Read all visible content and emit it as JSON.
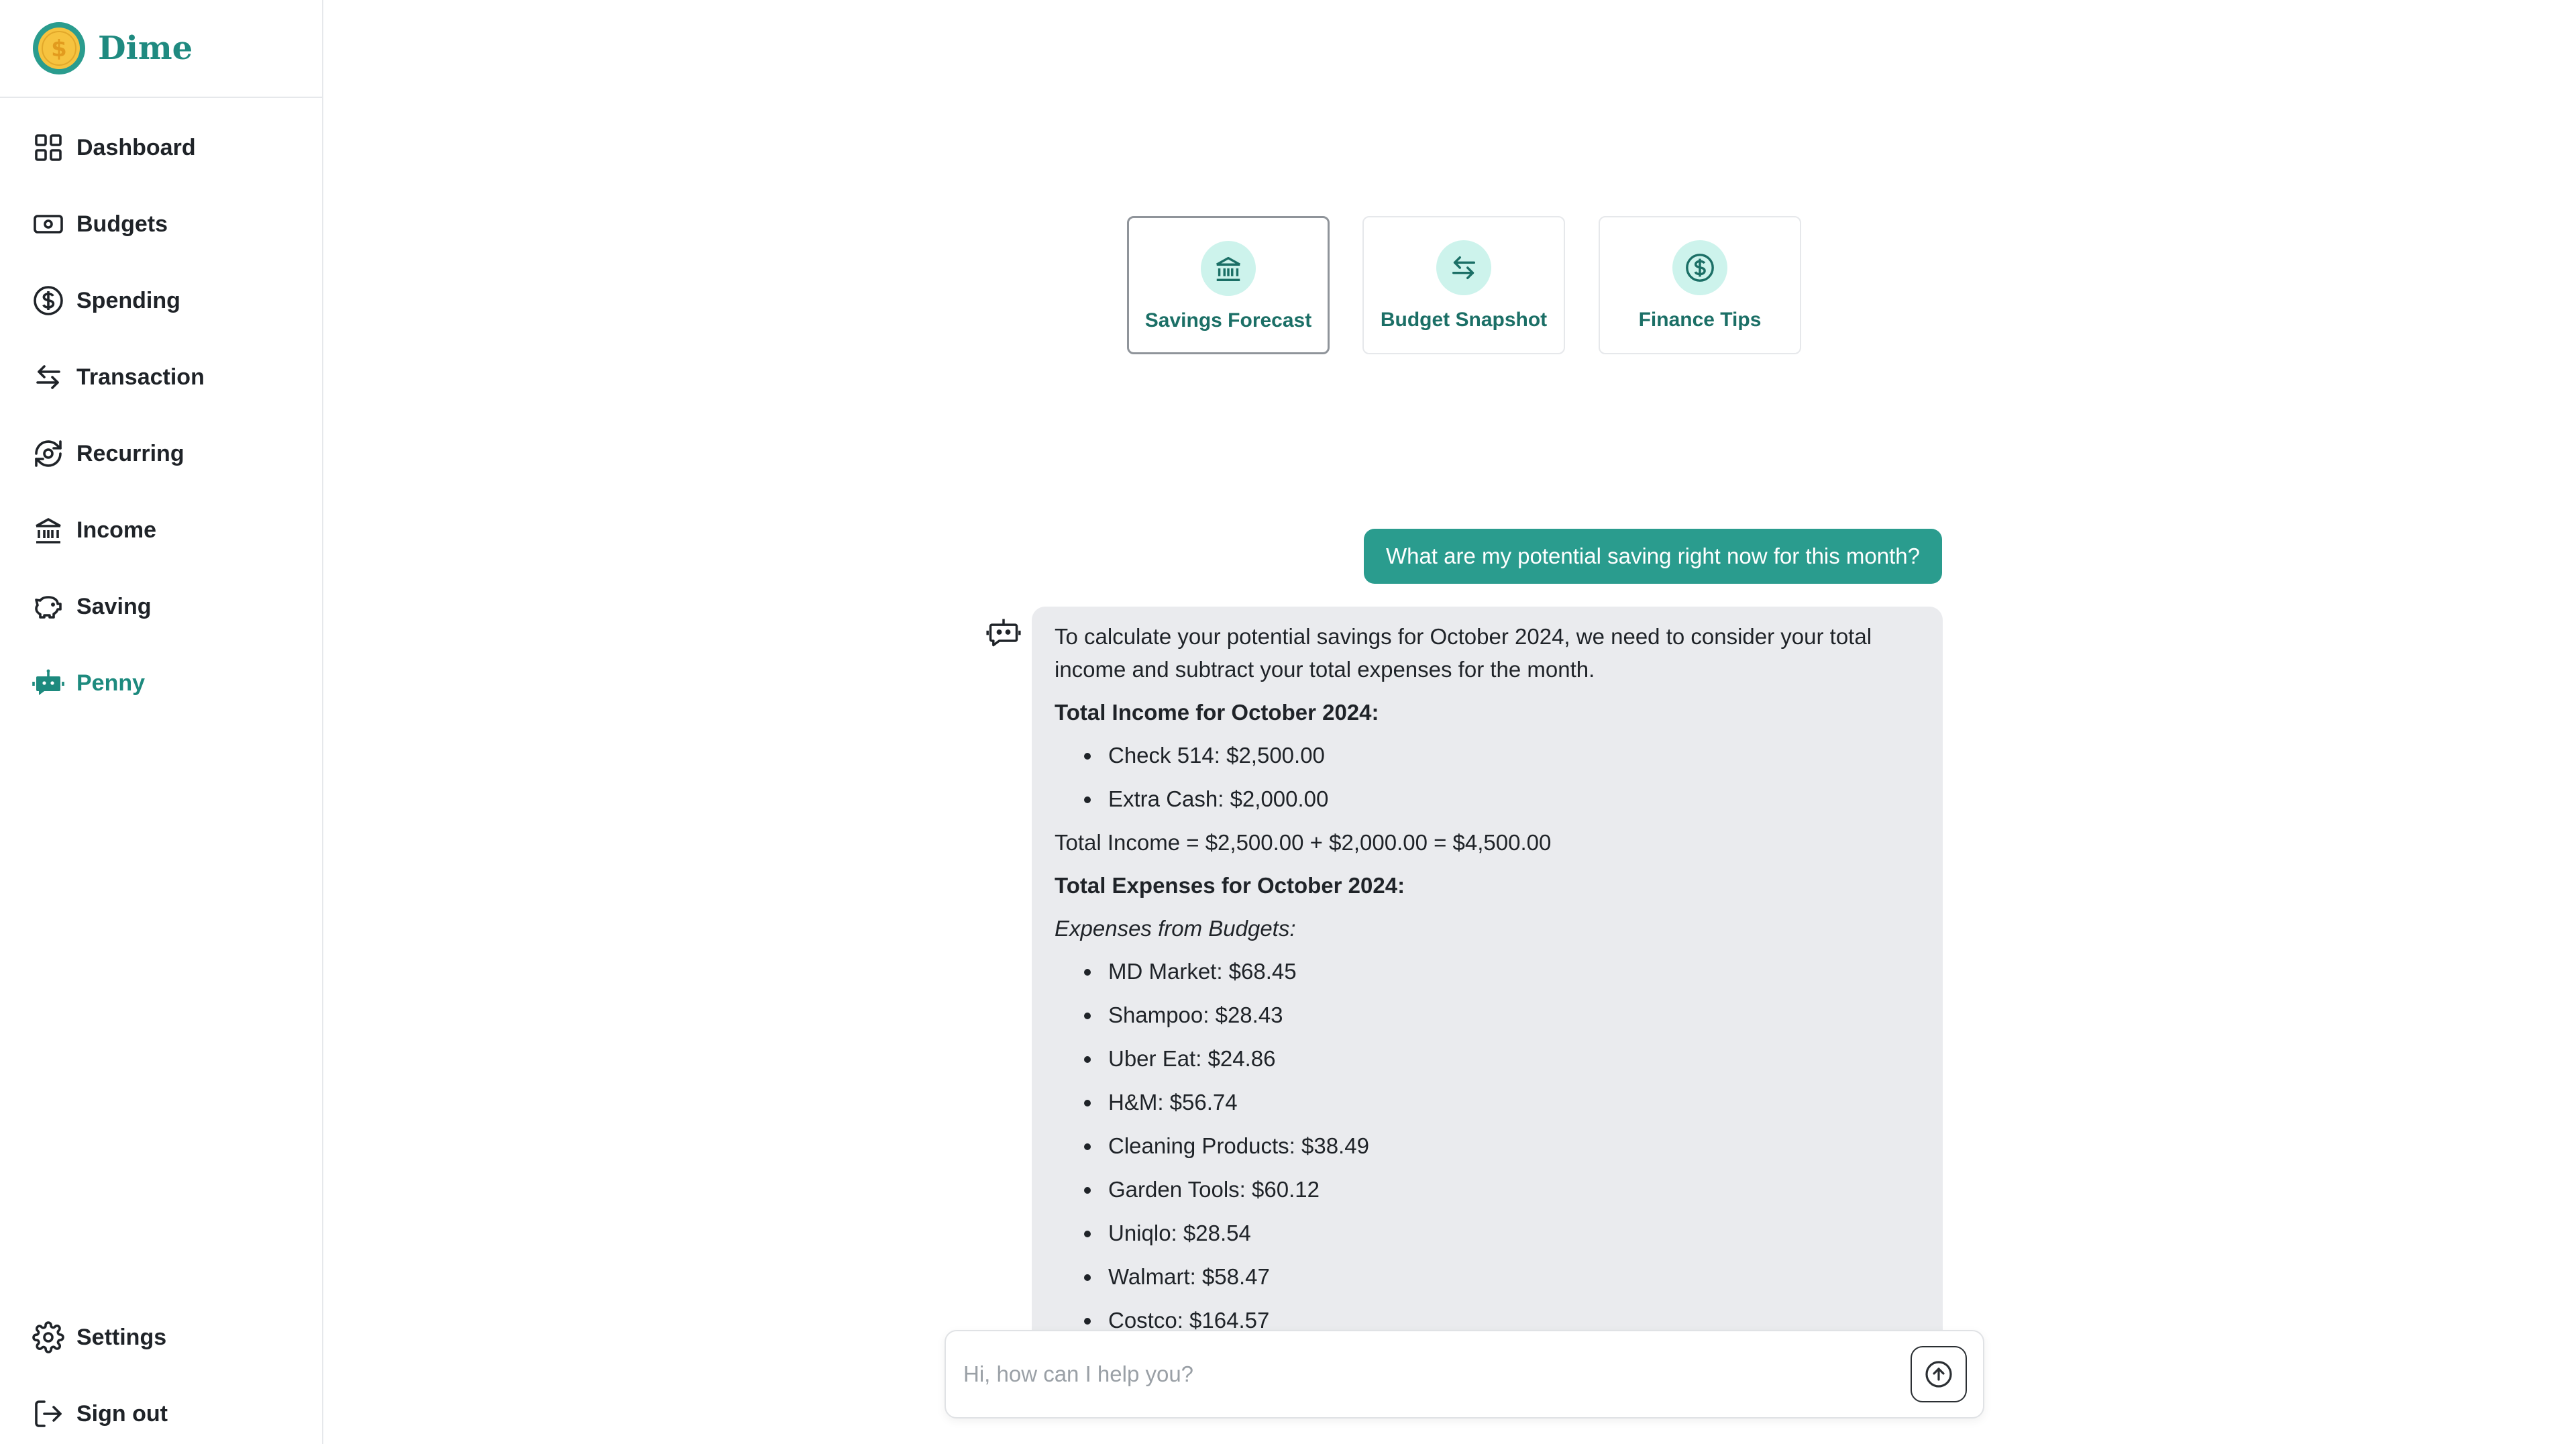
{
  "brand": {
    "name": "Dime",
    "logo_icon": "dollar-coin-icon",
    "accent_color": "#1f8a80"
  },
  "sidebar": {
    "items": [
      {
        "label": "Dashboard",
        "icon": "grid-icon"
      },
      {
        "label": "Budgets",
        "icon": "banknote-icon"
      },
      {
        "label": "Spending",
        "icon": "dollar-circle-icon"
      },
      {
        "label": "Transaction",
        "icon": "arrows-exchange-icon"
      },
      {
        "label": "Recurring",
        "icon": "recurring-icon"
      },
      {
        "label": "Income",
        "icon": "bank-icon"
      },
      {
        "label": "Saving",
        "icon": "piggy-bank-icon"
      },
      {
        "label": "Penny",
        "icon": "bot-icon",
        "active": true
      }
    ],
    "footer": [
      {
        "label": "Settings",
        "icon": "gear-icon"
      },
      {
        "label": "Sign out",
        "icon": "sign-out-icon"
      }
    ]
  },
  "suggestions": [
    {
      "label": "Savings Forecast",
      "icon": "bank-icon",
      "selected": true
    },
    {
      "label": "Budget Snapshot",
      "icon": "arrows-exchange-icon"
    },
    {
      "label": "Finance Tips",
      "icon": "dollar-circle-icon"
    }
  ],
  "chat": {
    "user_message": "What are my potential saving right now for this month?",
    "bot": {
      "intro": "To calculate your potential savings for October 2024, we need to consider your total income and subtract your total expenses for the month.",
      "income_heading": "Total Income for October 2024:",
      "income_items": [
        "Check 514: $2,500.00",
        "Extra Cash: $2,000.00"
      ],
      "income_total": "Total Income = $2,500.00 + $2,000.00 = $4,500.00",
      "expenses_heading": "Total Expenses for October 2024:",
      "expenses_subheading": "Expenses from Budgets:",
      "expense_items": [
        "MD Market: $68.45",
        "Shampoo: $28.43",
        "Uber Eat: $24.86",
        "H&M: $56.74",
        "Cleaning Products: $38.49",
        "Garden Tools: $60.12",
        "Uniqlo: $28.54",
        "Walmart: $58.47",
        "Costco: $164.57"
      ]
    }
  },
  "composer": {
    "placeholder": "Hi, how can I help you?",
    "value": ""
  }
}
